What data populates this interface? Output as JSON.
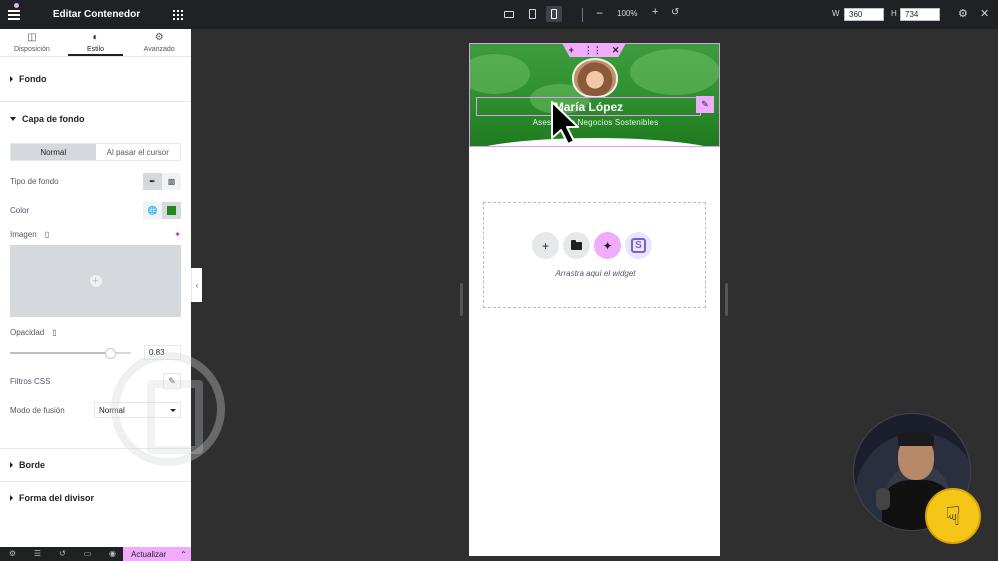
{
  "sidebar": {
    "header_title": "Editar Contenedor",
    "tabs": [
      {
        "label": "Disposición",
        "icon": "layout-columns-icon"
      },
      {
        "label": "Estilo",
        "icon": "half-circle-icon"
      },
      {
        "label": "Avanzado",
        "icon": "gear-icon"
      }
    ],
    "sections": {
      "fondo": "Fondo",
      "capa": "Capa de fondo",
      "borde": "Borde",
      "divisor": "Forma del divisor"
    },
    "state_toggle": {
      "normal": "Normal",
      "hover": "Al pasar el cursor"
    },
    "fields": {
      "tipo_label": "Tipo de fondo",
      "color_label": "Color",
      "color_value": "#1e8a1e",
      "imagen_label": "Imagen",
      "opacidad_label": "Opacidad",
      "opacidad_value": "0.83",
      "filtros_label": "Filtros CSS",
      "fusion_label": "Modo de fusión",
      "fusion_value": "Normal"
    },
    "footer": {
      "update_label": "Actualizar"
    }
  },
  "topbar": {
    "zoom": "100%",
    "width_label": "W",
    "width_value": "360",
    "height_label": "H",
    "height_value": "734"
  },
  "canvas": {
    "hero": {
      "name": "María López",
      "subtitle": "Asesora en Negocios Sostenibles",
      "bg_color": "#2d8f2d"
    },
    "dropzone_text": "Arrastra aquí el widget"
  },
  "colors": {
    "accent": "#f0abfc",
    "dark": "#1f2124",
    "canvas": "#2f2f2f"
  }
}
